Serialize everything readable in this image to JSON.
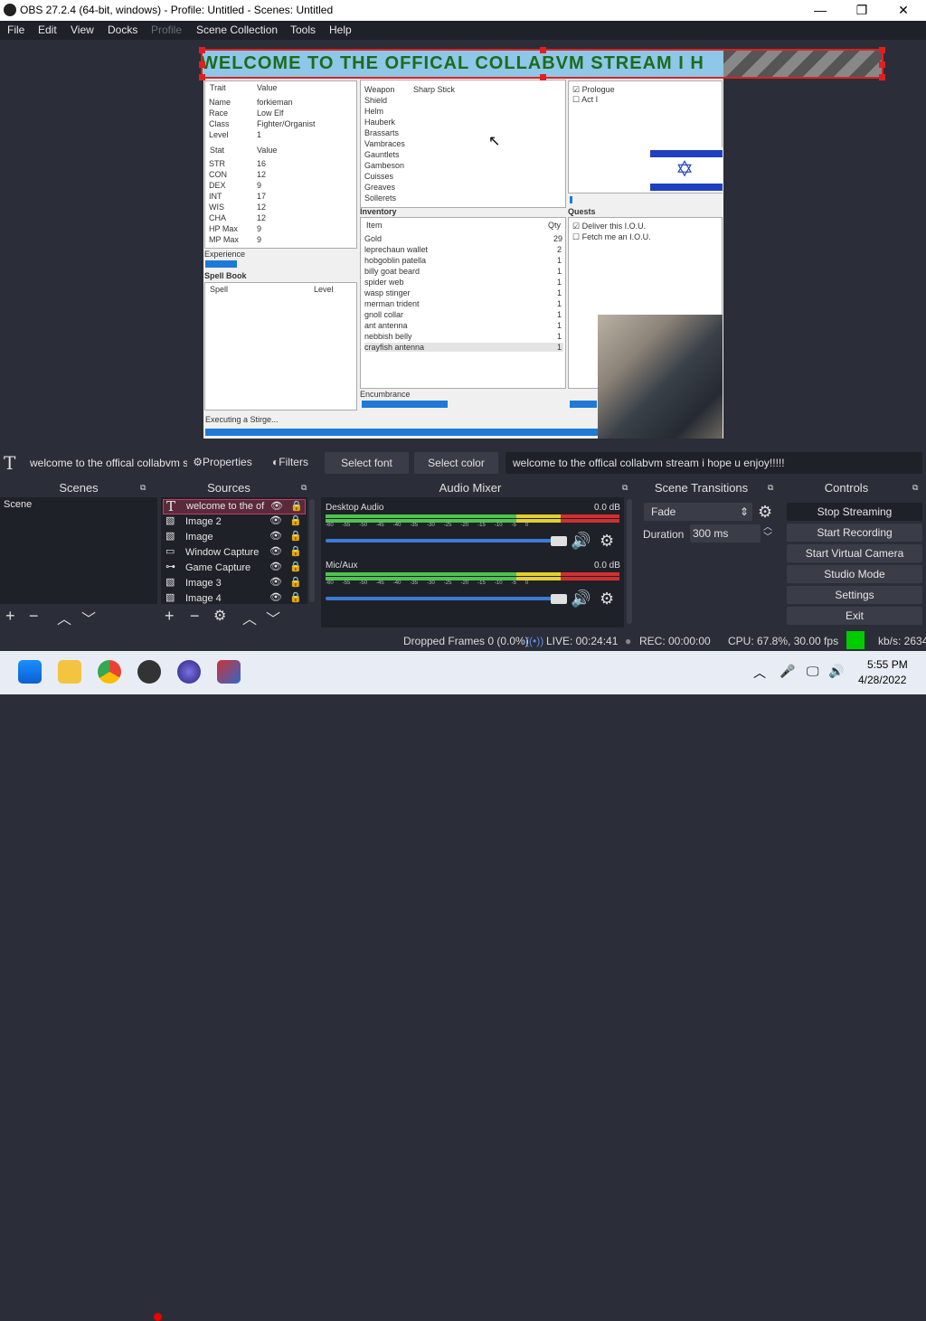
{
  "window": {
    "title": "OBS 27.2.4 (64-bit, windows) - Profile: Untitled - Scenes: Untitled",
    "controls": [
      "—",
      "❐",
      "✕"
    ]
  },
  "menu": [
    "File",
    "Edit",
    "View",
    "Docks",
    "Profile",
    "Scene Collection",
    "Tools",
    "Help"
  ],
  "stream": {
    "banner": "WELCOME TO THE OFFICAL COLLABVM STREAM I H",
    "trait_header": [
      "Trait",
      "Value"
    ],
    "traits": [
      [
        "Name",
        "forkieman"
      ],
      [
        "Race",
        "Low Elf"
      ],
      [
        "Class",
        "Fighter/Organist"
      ],
      [
        "Level",
        "1"
      ]
    ],
    "stat_header": [
      "Stat",
      "Value"
    ],
    "stats": [
      [
        "STR",
        "16"
      ],
      [
        "CON",
        "12"
      ],
      [
        "DEX",
        "9"
      ],
      [
        "INT",
        "17"
      ],
      [
        "WIS",
        "12"
      ],
      [
        "CHA",
        "12"
      ],
      [
        "HP Max",
        "9"
      ],
      [
        "MP Max",
        "9"
      ]
    ],
    "experience_label": "Experience",
    "spellbook_label": "Spell Book",
    "spell_header": [
      "Spell",
      "Level"
    ],
    "equipment": [
      [
        "Weapon",
        "Sharp Stick"
      ],
      [
        "Shield",
        ""
      ],
      [
        "Helm",
        ""
      ],
      [
        "Hauberk",
        ""
      ],
      [
        "Brassarts",
        ""
      ],
      [
        "Vambraces",
        ""
      ],
      [
        "Gauntlets",
        ""
      ],
      [
        "Gambeson",
        ""
      ],
      [
        "Cuisses",
        ""
      ],
      [
        "Greaves",
        ""
      ],
      [
        "Sollerets",
        ""
      ]
    ],
    "inventory_label": "Inventory",
    "inventory_header": [
      "Item",
      "Qty"
    ],
    "inventory": [
      [
        "Gold",
        "29"
      ],
      [
        "leprechaun wallet",
        "2"
      ],
      [
        "hobgoblin patella",
        "1"
      ],
      [
        "billy goat beard",
        "1"
      ],
      [
        "spider web",
        "1"
      ],
      [
        "wasp stinger",
        "1"
      ],
      [
        "merman trident",
        "1"
      ],
      [
        "gnoll collar",
        "1"
      ],
      [
        "ant antenna",
        "1"
      ],
      [
        "nebbish belly",
        "1"
      ],
      [
        "crayfish antenna",
        "1"
      ]
    ],
    "encumbrance_label": "Encumbrance",
    "plot": [
      "Prologue",
      "Act I"
    ],
    "quests_label": "Quests",
    "quests": [
      "Deliver this I.O.U.",
      "Fetch me an I.O.U."
    ],
    "status_text": "Executing a Stirge..."
  },
  "toolbar": {
    "source_name": "welcome to the offical collabvm st",
    "properties": "Properties",
    "filters": "Filters",
    "select_font": "Select font",
    "select_color": "Select color",
    "text_value": "welcome to the offical collabvm stream i hope u enjoy!!!!!"
  },
  "scenes": {
    "title": "Scenes",
    "items": [
      "Scene"
    ]
  },
  "sources": {
    "title": "Sources",
    "items": [
      {
        "label": "welcome to the of",
        "icon": "text-icon"
      },
      {
        "label": "Image 2",
        "icon": "image-icon"
      },
      {
        "label": "Image",
        "icon": "image-icon"
      },
      {
        "label": "Window Capture",
        "icon": "window-icon"
      },
      {
        "label": "Game Capture",
        "icon": "gamepad-icon"
      },
      {
        "label": "Image 3",
        "icon": "image-icon"
      },
      {
        "label": "Image 4",
        "icon": "image-icon"
      }
    ]
  },
  "mixer": {
    "title": "Audio Mixer",
    "channels": [
      {
        "name": "Desktop Audio",
        "level": "0.0 dB"
      },
      {
        "name": "Mic/Aux",
        "level": "0.0 dB"
      }
    ],
    "scale": [
      "-60",
      "-55",
      "-50",
      "-45",
      "-40",
      "-35",
      "-30",
      "-25",
      "-20",
      "-15",
      "-10",
      "-5",
      "0"
    ]
  },
  "transitions": {
    "title": "Scene Transitions",
    "type": "Fade",
    "duration_label": "Duration",
    "duration": "300 ms"
  },
  "controls": {
    "title": "Controls",
    "buttons": [
      "Stop Streaming",
      "Start Recording",
      "Start Virtual Camera",
      "Studio Mode",
      "Settings",
      "Exit"
    ]
  },
  "status": {
    "dropped": "Dropped Frames 0 (0.0%)",
    "live": "LIVE: 00:24:41",
    "rec": "REC: 00:00:00",
    "cpu": "CPU: 67.8%, 30.00 fps",
    "kbs": "kb/s: 2634"
  },
  "taskbar": {
    "time": "5:55 PM",
    "date": "4/28/2022"
  },
  "colors": {
    "accent": "#1e7ad6",
    "selection": "#e02020",
    "status_ok": "#00cc00"
  }
}
